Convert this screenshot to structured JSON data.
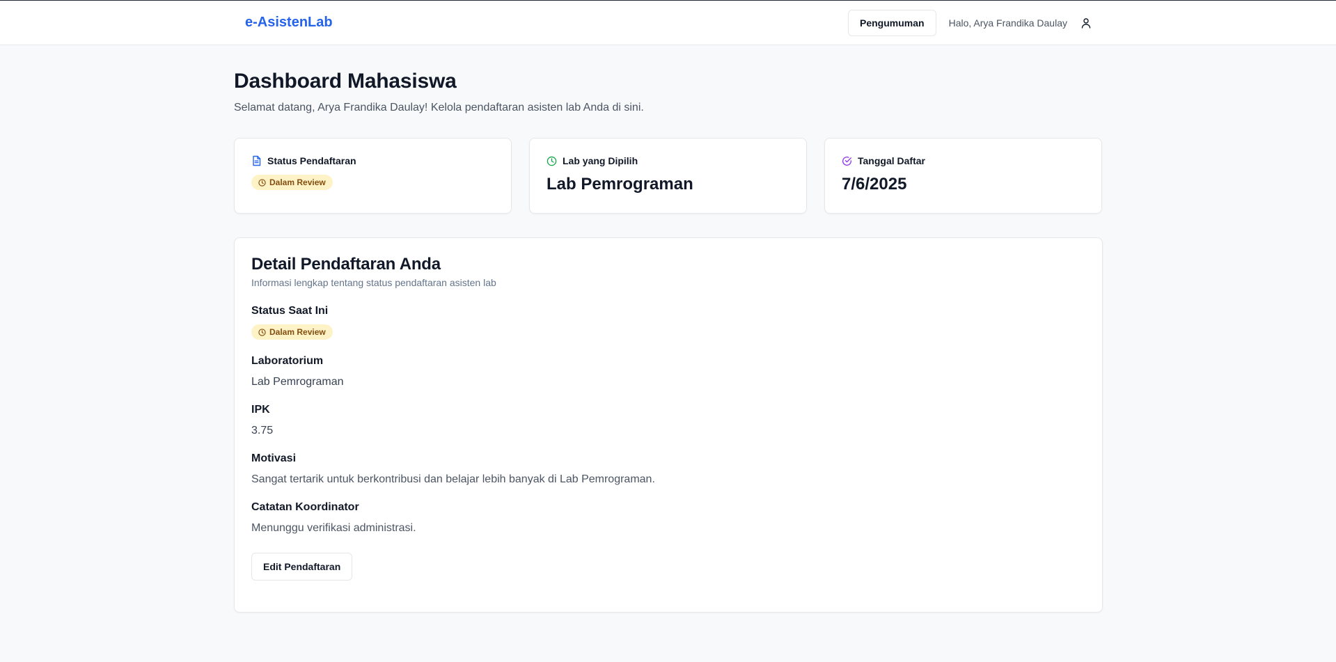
{
  "navbar": {
    "brand": "e-AsistenLab",
    "announcement_label": "Pengumuman",
    "greeting": "Halo, Arya Frandika Daulay",
    "user_icon": "user-icon"
  },
  "page": {
    "title": "Dashboard Mahasiswa",
    "subtitle": "Selamat datang, Arya Frandika Daulay! Kelola pendaftaran asisten lab Anda di sini."
  },
  "stats": [
    {
      "label": "Status Pendaftaran",
      "icon": "file-icon",
      "icon_color": "#2563eb",
      "badge": "Dalam Review"
    },
    {
      "label": "Lab yang Dipilih",
      "icon": "clock-icon",
      "icon_color": "#16a34a",
      "value": "Lab Pemrograman"
    },
    {
      "label": "Tanggal Daftar",
      "icon": "check-circle-icon",
      "icon_color": "#9333ea",
      "value": "7/6/2025"
    }
  ],
  "detail": {
    "title": "Detail Pendaftaran Anda",
    "description": "Informasi lengkap tentang status pendaftaran asisten lab",
    "status_label": "Status Saat Ini",
    "status_badge": "Dalam Review",
    "lab_label": "Laboratorium",
    "lab_value": "Lab Pemrograman",
    "ipk_label": "IPK",
    "ipk_value": "3.75",
    "motivation_label": "Motivasi",
    "motivation_value": "Sangat tertarik untuk berkontribusi dan belajar lebih banyak di Lab Pemrograman.",
    "note_label": "Catatan Koordinator",
    "note_value": "Menunggu verifikasi administrasi.",
    "edit_label": "Edit Pendaftaran"
  },
  "colors": {
    "brand": "#2563eb",
    "badge_bg": "#fef3c7",
    "badge_text": "#854d0e"
  }
}
